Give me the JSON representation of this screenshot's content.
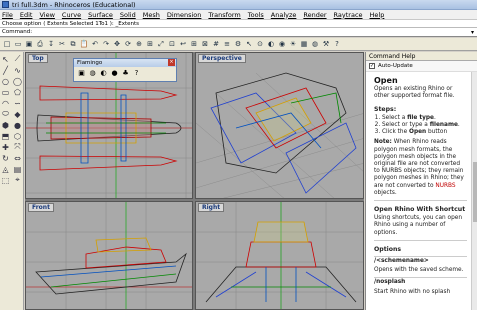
{
  "window": {
    "title": "tri full.3dm - Rhinoceros (Educational)"
  },
  "menu": [
    "File",
    "Edit",
    "View",
    "Curve",
    "Surface",
    "Solid",
    "Mesh",
    "Dimension",
    "Transform",
    "Tools",
    "Analyze",
    "Render",
    "Raytrace",
    "Help"
  ],
  "command": {
    "history": "Choose option ( Extents  Selected  1To1 ): _Extents",
    "prompt": "Command:"
  },
  "toolbar_icons": [
    "new-file-icon",
    "open-file-icon",
    "save-icon",
    "print-icon",
    "import-icon",
    "cut-icon",
    "copy-icon",
    "paste-icon",
    "undo-icon",
    "redo-icon",
    "pan-icon",
    "rotate-view-icon",
    "zoom-icon",
    "zoom-window-icon",
    "zoom-extents-icon",
    "zoom-selected-icon",
    "undo-view-icon",
    "four-viewports-icon",
    "cplane-icon",
    "grid-icon",
    "layer-icon",
    "properties-icon",
    "select-icon",
    "osnap-icon",
    "shade-icon",
    "render-icon",
    "light-icon",
    "texture-icon",
    "environment-icon",
    "options-icon",
    "help-icon"
  ],
  "toolbar_glyphs": [
    "□",
    "▭",
    "▣",
    "⎙",
    "↧",
    "✂",
    "⧉",
    "📋",
    "↶",
    "↷",
    "✥",
    "⟳",
    "⊕",
    "⊞",
    "⤢",
    "⊡",
    "↩",
    "⊞",
    "⊠",
    "#",
    "≡",
    "⚙",
    "↖",
    "⊙",
    "◐",
    "◉",
    "☀",
    "▦",
    "◍",
    "⚒",
    "?"
  ],
  "left_tools": [
    "↖",
    "⟋",
    "╱",
    "∿",
    "○",
    "◯",
    "▭",
    "⬠",
    "◠",
    "∽",
    "⬭",
    "◆",
    "⬢",
    "●",
    "⬒",
    "⬡",
    "✚",
    "⤧",
    "↻",
    "⇔",
    "◬",
    "▤",
    "⬚",
    "⌖"
  ],
  "viewports": [
    {
      "label": "Top"
    },
    {
      "label": "Perspective"
    },
    {
      "label": "Front"
    },
    {
      "label": "Right"
    }
  ],
  "flamingo": {
    "title": "Flamingo",
    "icons": [
      "render-icon",
      "material-icon",
      "environment-icon",
      "sun-icon",
      "plant-icon",
      "help-icon"
    ],
    "glyphs": [
      "▣",
      "◍",
      "◐",
      "●",
      "♣",
      "?"
    ]
  },
  "help_panel": {
    "header": "Command Help",
    "auto_update_label": "Auto-Update",
    "auto_update_checked": true,
    "title": "Open",
    "intro": "Opens an existing Rhino or other supported format file.",
    "steps_heading": "Steps:",
    "steps": [
      {
        "pre": "Select a ",
        "bold": "file type",
        "post": "."
      },
      {
        "pre": "Select or type a ",
        "bold": "filename",
        "post": "."
      },
      {
        "pre": "Click the ",
        "bold": "Open",
        "post": " button"
      }
    ],
    "note_label": "Note:",
    "note_text": " When Rhino reads polygon mesh formats, the polygon mesh objects in the original file are not converted to NURBS objects; they remain polygon meshes in Rhino; they are not converted to ",
    "note_link": "NURBS",
    "note_end": " objects.",
    "shortcut_heading": "Open Rhino With Shortcut",
    "shortcut_text": "Using shortcuts, you can open Rhino using a number of options.",
    "options_heading": "Options",
    "opt1_name": "/<schemename>",
    "opt1_desc": "Opens with the saved scheme.",
    "opt2_name": "/nosplash",
    "opt2_desc": "Start Rhino with no splash"
  }
}
